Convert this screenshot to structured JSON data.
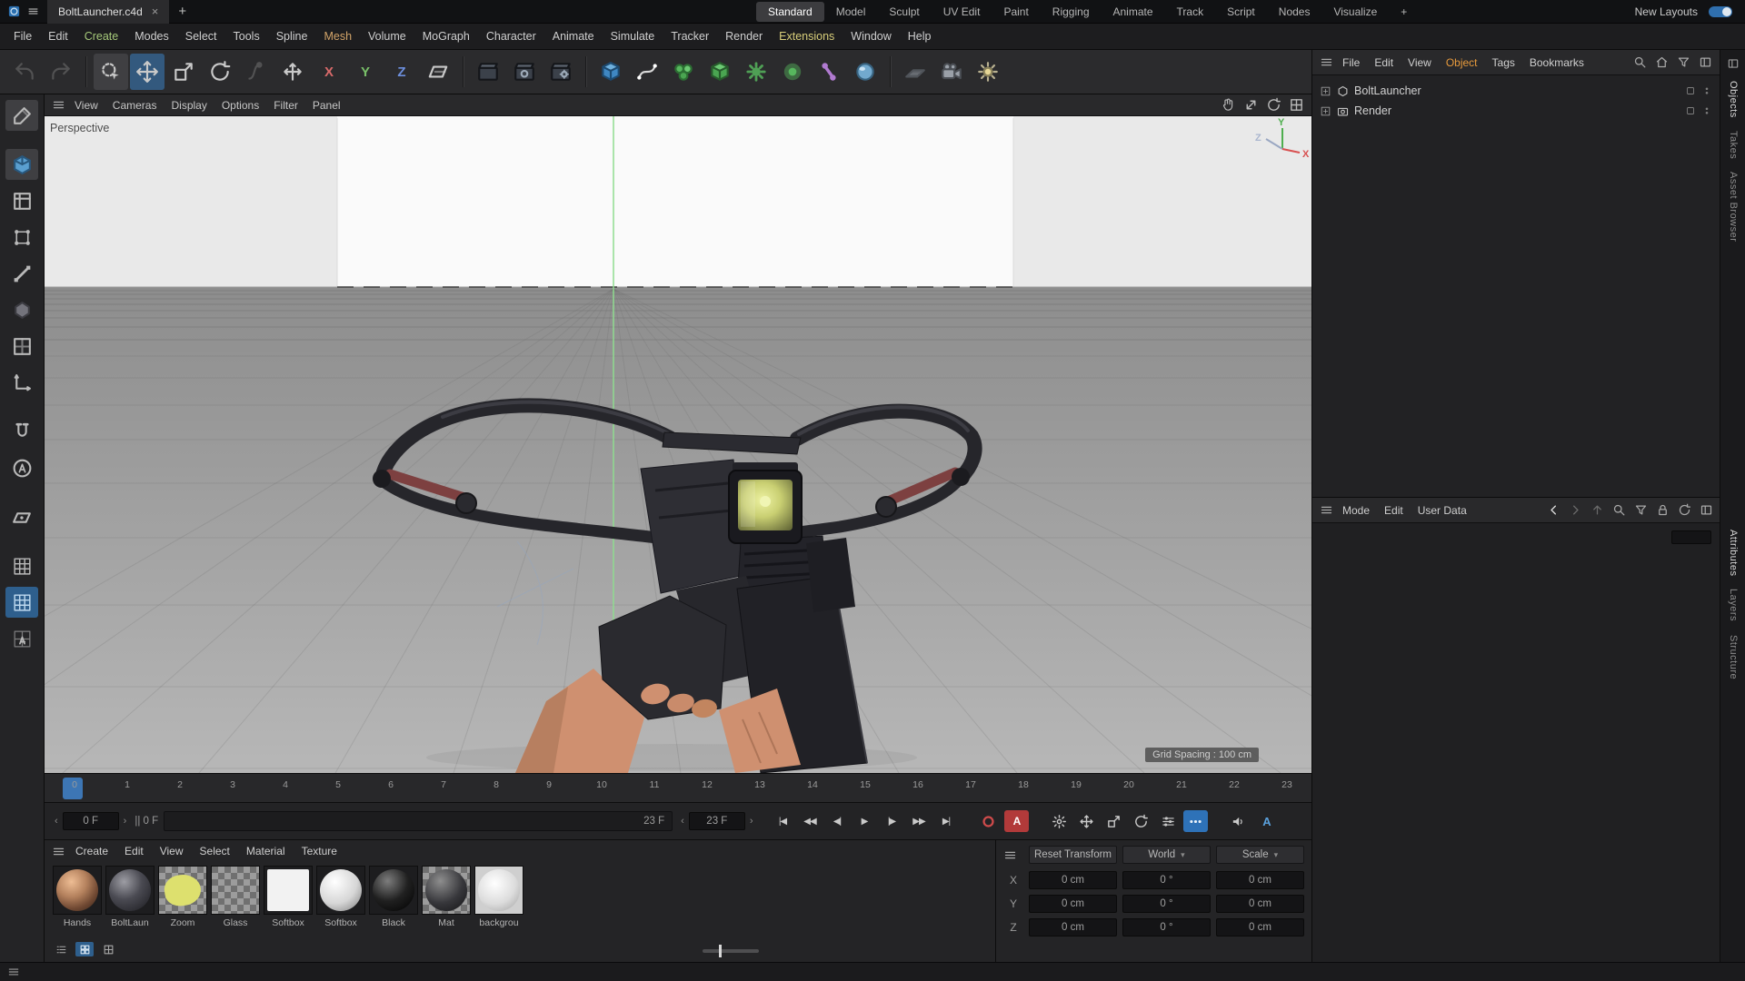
{
  "titlebar": {
    "doc_tab": "BoltLauncher.c4d",
    "close_glyph": "×",
    "new_tab_glyph": "+",
    "layout_tabs": [
      {
        "label": "Standard",
        "active": true
      },
      {
        "label": "Model"
      },
      {
        "label": "Sculpt"
      },
      {
        "label": "UV Edit"
      },
      {
        "label": "Paint"
      },
      {
        "label": "Rigging"
      },
      {
        "label": "Animate"
      },
      {
        "label": "Track"
      },
      {
        "label": "Script"
      },
      {
        "label": "Nodes"
      },
      {
        "label": "Visualize"
      },
      {
        "label": "+"
      }
    ],
    "new_layouts": "New Layouts"
  },
  "menubar": [
    {
      "label": "File"
    },
    {
      "label": "Edit"
    },
    {
      "label": "Create",
      "color": "#a6c97a"
    },
    {
      "label": "Modes"
    },
    {
      "label": "Select"
    },
    {
      "label": "Tools"
    },
    {
      "label": "Spline"
    },
    {
      "label": "Mesh",
      "color": "#d2a469"
    },
    {
      "label": "Volume"
    },
    {
      "label": "MoGraph"
    },
    {
      "label": "Character"
    },
    {
      "label": "Animate"
    },
    {
      "label": "Simulate"
    },
    {
      "label": "Tracker"
    },
    {
      "label": "Render"
    },
    {
      "label": "Extensions",
      "color": "#d8ce7a"
    },
    {
      "label": "Window"
    },
    {
      "label": "Help"
    }
  ],
  "toolbar_groups": [
    {
      "buttons": [
        {
          "icon": "undo-icon",
          "disabled": true
        },
        {
          "icon": "redo-icon",
          "disabled": true
        }
      ]
    },
    {
      "buttons": [
        {
          "icon": "live-selection-icon",
          "state": "pressed"
        },
        {
          "icon": "move-icon",
          "state": "selected"
        },
        {
          "icon": "scale-icon"
        },
        {
          "icon": "rotate-icon"
        },
        {
          "icon": "last-tool-icon",
          "disabled": true
        },
        {
          "icon": "global-axes-icon"
        },
        {
          "icon": "x-axis-icon",
          "text": "X"
        },
        {
          "icon": "y-axis-icon",
          "text": "Y"
        },
        {
          "icon": "z-axis-icon",
          "text": "Z"
        },
        {
          "icon": "workplane-icon"
        }
      ]
    },
    {
      "buttons": [
        {
          "icon": "render-view-icon"
        },
        {
          "icon": "render-picture-viewer-icon"
        },
        {
          "icon": "render-settings-icon"
        }
      ]
    },
    {
      "buttons": [
        {
          "icon": "cube-primitive-icon"
        },
        {
          "icon": "spline-pen-icon"
        },
        {
          "icon": "mograph-icon"
        },
        {
          "icon": "volume-icon"
        },
        {
          "icon": "simulate-icon"
        },
        {
          "icon": "field-icon"
        },
        {
          "icon": "character-icon"
        },
        {
          "icon": "dynamics-icon"
        }
      ]
    },
    {
      "buttons": [
        {
          "icon": "floor-icon"
        },
        {
          "icon": "camera-icon"
        },
        {
          "icon": "light-icon"
        }
      ]
    }
  ],
  "left_tools": [
    {
      "icon": "make-editable-icon",
      "state": "pressed"
    },
    {
      "icon": "model-mode-icon",
      "state": "pressed",
      "gap": true
    },
    {
      "icon": "texture-mode-icon"
    },
    {
      "icon": "point-mode-icon"
    },
    {
      "icon": "edge-mode-icon"
    },
    {
      "icon": "polygon-mode-icon"
    },
    {
      "icon": "uv-mode-icon",
      "disabled": true
    },
    {
      "icon": "axis-mode-icon"
    },
    {
      "icon": "snap-icon",
      "gap": true
    },
    {
      "icon": "quantize-icon"
    },
    {
      "icon": "workplane-tool-icon",
      "gap": true
    },
    {
      "icon": "grid-icon",
      "gap": true
    },
    {
      "icon": "workplane-grid-icon",
      "state": "selected"
    },
    {
      "icon": "grid-a-icon"
    }
  ],
  "viewport": {
    "menus": [
      "View",
      "Cameras",
      "Display",
      "Options",
      "Filter",
      "Panel"
    ],
    "nav_icons": [
      "pan-icon",
      "dolly-icon",
      "orbit-icon",
      "toggle-view-icon"
    ],
    "label": "Perspective",
    "grid_label": "Grid Spacing : 100 cm",
    "axes": {
      "x": "X",
      "y": "Y",
      "z": "Z"
    }
  },
  "timeline": {
    "ticks": [
      "0",
      "1",
      "2",
      "3",
      "4",
      "5",
      "6",
      "7",
      "8",
      "9",
      "10",
      "11",
      "12",
      "13",
      "14",
      "15",
      "16",
      "17",
      "18",
      "19",
      "20",
      "21",
      "22",
      "23"
    ],
    "marker_index": 0
  },
  "transport": {
    "frame_start": "0 F",
    "range_start": "|| 0 F",
    "range_end": "23 F",
    "frame_end_field": "23 F",
    "prev_glyph": "‹",
    "next_glyph": "›",
    "playback": [
      "go-start-icon",
      "prev-key-icon",
      "prev-frame-icon",
      "play-icon",
      "next-frame-icon",
      "next-key-icon",
      "go-end-icon"
    ],
    "record": [
      {
        "icon": "record-icon",
        "cls": "red-fg"
      },
      {
        "icon": "autokey-icon",
        "cls": "red-bg",
        "text": "A"
      }
    ],
    "toggles": [
      {
        "icon": "keyframe-settings-icon"
      },
      {
        "icon": "key-position-icon"
      },
      {
        "icon": "key-scale-icon"
      },
      {
        "icon": "key-rotation-icon"
      },
      {
        "icon": "key-parameter-icon"
      },
      {
        "icon": "key-pla-icon",
        "cls": "blue-bg"
      }
    ],
    "audio": [
      {
        "icon": "sound-icon"
      },
      {
        "icon": "autokey-selection-icon",
        "cls": "blue-fg",
        "text": "A"
      }
    ]
  },
  "materials": {
    "menus": [
      "Create",
      "Edit",
      "View",
      "Select",
      "Material",
      "Texture"
    ],
    "items": [
      {
        "name": "Hands",
        "kind": "sphere-skin"
      },
      {
        "name": "BoltLaun",
        "kind": "sphere-dark"
      },
      {
        "name": "Zoom",
        "kind": "blob-yellow"
      },
      {
        "name": "Glass",
        "kind": "checker"
      },
      {
        "name": "Softbox",
        "kind": "square-white"
      },
      {
        "name": "Softbox",
        "kind": "sphere-white"
      },
      {
        "name": "Black",
        "kind": "sphere-black"
      },
      {
        "name": "Mat",
        "kind": "sphere-gray"
      },
      {
        "name": "backgrou",
        "kind": "sphere-light"
      }
    ],
    "view_icons": [
      "list-view-icon",
      "thumb-view-icon",
      "small-thumb-icon"
    ]
  },
  "coordinates": {
    "reset_button": "Reset Transform",
    "space_dropdown": "World",
    "mode_dropdown": "Scale",
    "chevron": "▾",
    "rows": [
      {
        "axis": "X",
        "pos": "0 cm",
        "rot": "0 °",
        "scale": "0 cm"
      },
      {
        "axis": "Y",
        "pos": "0 cm",
        "rot": "0 °",
        "scale": "0 cm"
      },
      {
        "axis": "Z",
        "pos": "0 cm",
        "rot": "0 °",
        "scale": "0 cm"
      }
    ]
  },
  "object_manager": {
    "menus": [
      {
        "label": "File"
      },
      {
        "label": "Edit"
      },
      {
        "label": "View"
      },
      {
        "label": "Object",
        "color": "#e79a3c"
      },
      {
        "label": "Tags"
      },
      {
        "label": "Bookmarks"
      }
    ],
    "header_icons": [
      "search-icon",
      "home-icon",
      "filter-icon",
      "panel-icon"
    ],
    "objects": [
      {
        "name": "BoltLauncher",
        "icon": "null-object-icon"
      },
      {
        "name": "Render",
        "icon": "render-object-icon"
      }
    ]
  },
  "attribute_manager": {
    "menus": [
      "Mode",
      "Edit",
      "User Data"
    ],
    "header_icons": [
      {
        "icon": "back-arrow-icon",
        "cls": "bright"
      },
      {
        "icon": "forward-arrow-icon",
        "cls": "dim"
      },
      {
        "icon": "up-arrow-icon",
        "cls": "dim"
      },
      {
        "icon": "search-icon"
      },
      {
        "icon": "filter-icon"
      },
      {
        "icon": "lock-icon"
      },
      {
        "icon": "refresh-icon"
      },
      {
        "icon": "panel-icon"
      }
    ]
  },
  "side_tabs": {
    "top": [
      {
        "label": "Objects",
        "active": true
      },
      {
        "label": "Takes"
      },
      {
        "label": "Asset Browser"
      }
    ],
    "bottom": [
      {
        "label": "Attributes",
        "active": true
      },
      {
        "label": "Layers"
      },
      {
        "label": "Structure"
      }
    ]
  }
}
